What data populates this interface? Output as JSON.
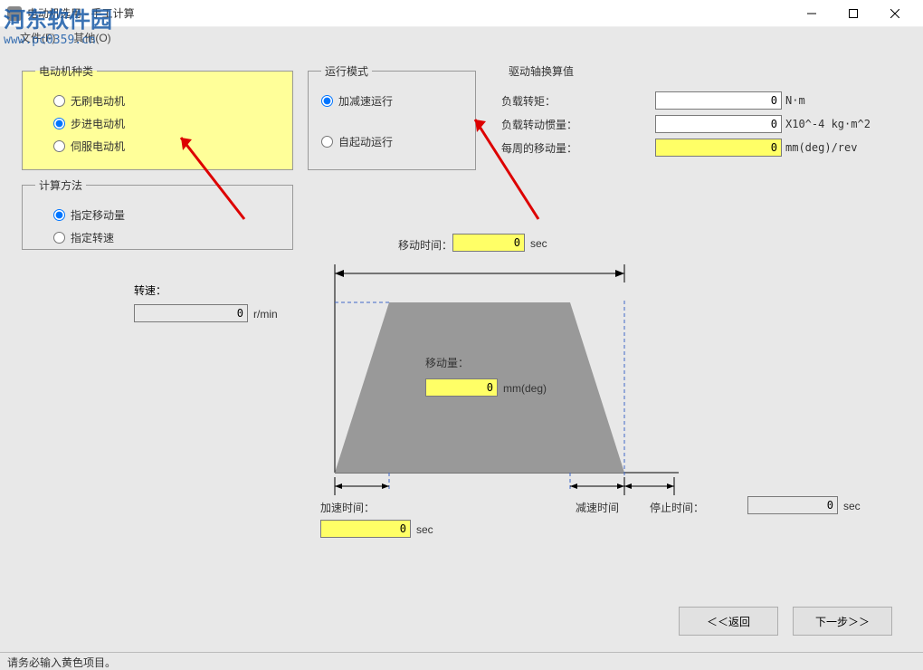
{
  "window": {
    "title": "电动机选用 - 手工计算"
  },
  "menu": {
    "file": "文件(F)",
    "other": "其他(O)"
  },
  "motor_type": {
    "legend": "电动机种类",
    "opt1": "无刷电动机",
    "opt2": "步进电动机",
    "opt3": "伺服电动机"
  },
  "calc_method": {
    "legend": "计算方法",
    "opt1": "指定移动量",
    "opt2": "指定转速"
  },
  "run_mode": {
    "legend": "运行模式",
    "opt1": "加减速运行",
    "opt2": "自起动运行"
  },
  "drive": {
    "legend": "驱动轴换算值",
    "torque_label": "负载转矩：",
    "torque_val": "0",
    "torque_unit": "N·m",
    "inertia_label": "负载转动惯量：",
    "inertia_val": "0",
    "inertia_unit": "X10^-4 kg·m^2",
    "perrev_label": "每周的移动量：",
    "perrev_val": "0",
    "perrev_unit": "mm(deg)/rev"
  },
  "diagram": {
    "speed_label": "转速：",
    "speed_val": "0",
    "speed_unit": "r/min",
    "move_time_label": "移动时间：",
    "move_time_val": "0",
    "move_time_unit": "sec",
    "move_amt_label": "移动量：",
    "move_amt_val": "0",
    "move_amt_unit": "mm(deg)",
    "accel_label": "加速时间：",
    "accel_val": "0",
    "accel_unit": "sec",
    "decel_label": "减速时间",
    "stop_label": "停止时间：",
    "stop_val": "0",
    "stop_unit": "sec"
  },
  "buttons": {
    "back": "＜＜返回",
    "next": "下一步＞＞"
  },
  "status": "请务必输入黄色项目。",
  "watermark": {
    "line1": "河东软件园",
    "line2": "www.pc0359.cn"
  }
}
